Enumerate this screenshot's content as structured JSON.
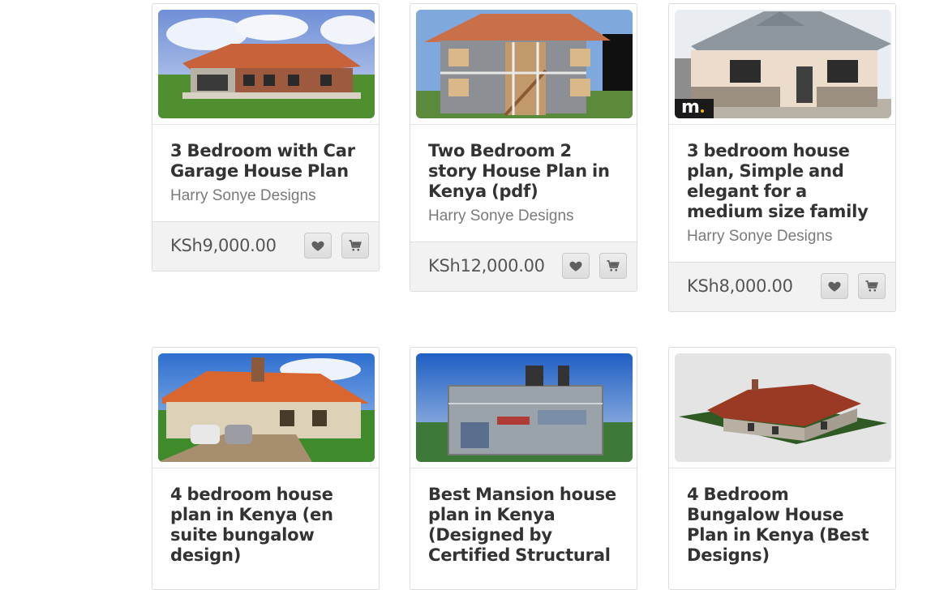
{
  "products": [
    {
      "title": "3 Bedroom with Car Garage House Plan",
      "vendor": "Harry Sonye Designs",
      "price": "KSh9,000.00",
      "image": "bungalow-with-garage-render"
    },
    {
      "title": "Two Bedroom 2 story House Plan in Kenya (pdf)",
      "vendor": "Harry Sonye Designs",
      "price": "KSh12,000.00",
      "image": "two-story-house-render"
    },
    {
      "title": "3 bedroom house plan, Simple and elegant for a medium size family",
      "vendor": "Harry Sonye Designs",
      "price": "KSh8,000.00",
      "image": "simple-bungalow-photo",
      "badge": "m"
    },
    {
      "title": "4 bedroom house plan in Kenya (en suite bungalow design)",
      "vendor": "",
      "price": "",
      "image": "ensuite-bungalow-render"
    },
    {
      "title": "Best Mansion house plan in Kenya (Designed by Certified Structural",
      "vendor": "",
      "price": "",
      "image": "stone-mansion-render"
    },
    {
      "title": "4 Bedroom Bungalow House Plan in Kenya (Best Designs)",
      "vendor": "",
      "price": "",
      "image": "bungalow-model-render"
    }
  ],
  "icons": {
    "wishlist": "heart-icon",
    "cart": "cart-icon"
  },
  "colors": {
    "title": "#333333",
    "vendor": "#7a7a7a",
    "price": "#555555",
    "footer_bg": "#f2f2f2",
    "card_border": "#dcdcdc"
  }
}
